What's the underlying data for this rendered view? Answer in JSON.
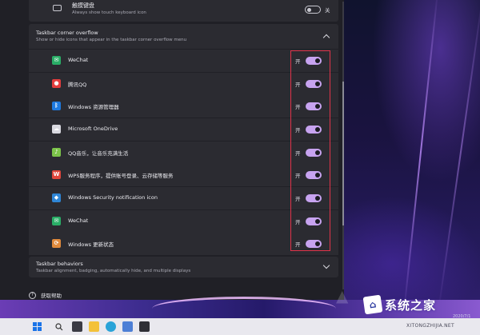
{
  "keyboard": {
    "title": "触摸键盘",
    "subtitle": "Always show touch keyboard icon",
    "state_label": "关",
    "enabled": false
  },
  "overflow": {
    "title": "Taskbar corner overflow",
    "subtitle": "Show or hide icons that appear in the taskbar corner overflow menu",
    "items": [
      {
        "name": "WeChat",
        "state_label": "开",
        "enabled": true,
        "icon": "wechat-icon",
        "icon_color": "#2aae67",
        "glyph": "✉"
      },
      {
        "name": "腾讯QQ",
        "state_label": "开",
        "enabled": true,
        "icon": "qq-icon",
        "icon_color": "#e33d3d",
        "glyph": "●"
      },
      {
        "name": "Windows 资源管理器",
        "state_label": "开",
        "enabled": true,
        "icon": "bluetooth-icon",
        "icon_color": "#1e7ae0",
        "glyph": "ᛒ"
      },
      {
        "name": "Microsoft OneDrive",
        "state_label": "开",
        "enabled": true,
        "icon": "onedrive-icon",
        "icon_color": "#d9d9e0",
        "glyph": "☁"
      },
      {
        "name": "QQ音乐，让音乐充满生活",
        "state_label": "开",
        "enabled": true,
        "icon": "qq-music-icon",
        "icon_color": "#7cc44a",
        "glyph": "♪"
      },
      {
        "name": "WPS服务程序，提供账号登录、云存储等服务",
        "state_label": "开",
        "enabled": true,
        "icon": "wps-icon",
        "icon_color": "#e0463c",
        "glyph": "W"
      },
      {
        "name": "Windows Security notification icon",
        "state_label": "开",
        "enabled": true,
        "icon": "security-icon",
        "icon_color": "#2f86d6",
        "glyph": "◆"
      },
      {
        "name": "WeChat",
        "state_label": "开",
        "enabled": true,
        "icon": "wechat-icon",
        "icon_color": "#2aae67",
        "glyph": "✉"
      },
      {
        "name": "Windows 更新状态",
        "state_label": "开",
        "enabled": true,
        "icon": "windows-update-icon",
        "icon_color": "#e08a3c",
        "glyph": "⟳"
      }
    ]
  },
  "behaviors": {
    "title": "Taskbar behaviors",
    "subtitle": "Taskbar alignment, badging, automatically hide, and multiple displays"
  },
  "help": {
    "label": "获取帮助"
  },
  "watermark": {
    "brand_text": "系统之家",
    "url_text": "XITONGZHIJIA.NET",
    "date_text": "2020/7/1"
  },
  "colors": {
    "toggle_on": "#c7a3f0",
    "highlight_box": "#e0334a",
    "panel": "#2b2b31"
  }
}
